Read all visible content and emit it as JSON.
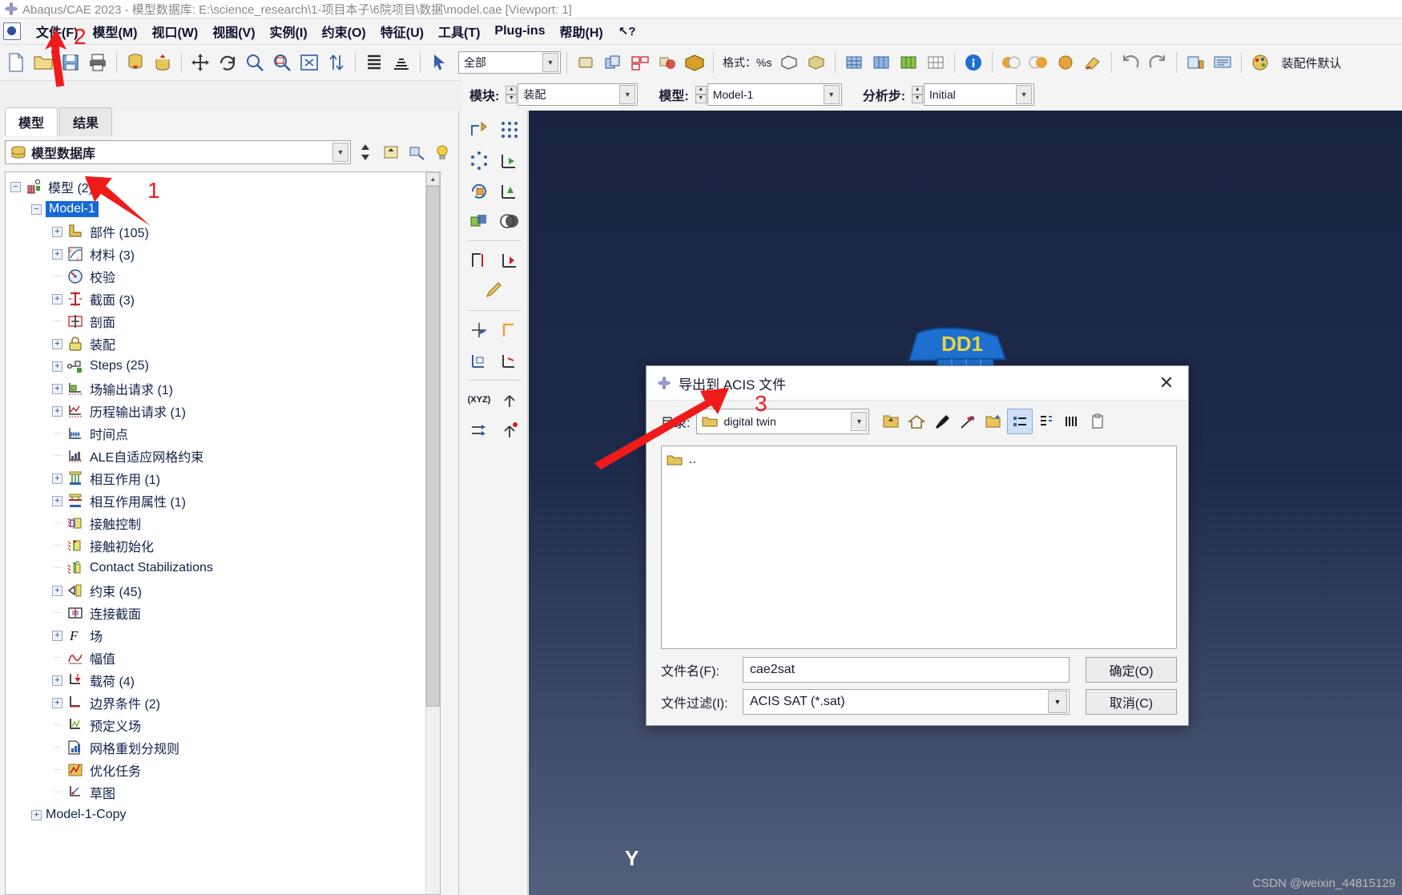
{
  "window": {
    "title": "Abaqus/CAE 2023 - 模型数据库: E:\\science_research\\1-项目本子\\6院项目\\数据\\model.cae [Viewport: 1]",
    "app_icon": "abaqus-logo-icon"
  },
  "menubar": {
    "items": [
      {
        "label": "文件(F)",
        "name": "menu-file"
      },
      {
        "label": "模型(M)",
        "name": "menu-model"
      },
      {
        "label": "视口(W)",
        "name": "menu-viewport"
      },
      {
        "label": "视图(V)",
        "name": "menu-view"
      },
      {
        "label": "实例(I)",
        "name": "menu-instance"
      },
      {
        "label": "约束(O)",
        "name": "menu-constraint"
      },
      {
        "label": "特征(U)",
        "name": "menu-feature"
      },
      {
        "label": "工具(T)",
        "name": "menu-tools"
      },
      {
        "label": "Plug-ins",
        "name": "menu-plugins"
      },
      {
        "label": "帮助(H)",
        "name": "menu-help"
      }
    ],
    "context_help": "↖?"
  },
  "toolbar": {
    "selection_scope": "全部",
    "render_style_label": "格式：%s",
    "assembly_default_label": "装配件默认"
  },
  "context_bar": {
    "module_label": "模块:",
    "module_value": "装配",
    "model_label": "模型:",
    "model_value": "Model-1",
    "step_label": "分析步:",
    "step_value": "Initial"
  },
  "left_panel": {
    "tabs": [
      {
        "label": "模型",
        "active": true,
        "name": "tab-model"
      },
      {
        "label": "结果",
        "active": false,
        "name": "tab-results"
      }
    ],
    "tree_selector": "模型数据库",
    "tree": [
      {
        "label": "模型 (2)",
        "depth": 0,
        "expander": "minus",
        "icon": "models-icon",
        "selected": false
      },
      {
        "label": "Model-1",
        "depth": 1,
        "expander": "minus",
        "icon": "",
        "selected": true
      },
      {
        "label": "部件 (105)",
        "depth": 2,
        "expander": "plus",
        "icon": "parts-icon",
        "selected": false
      },
      {
        "label": "材料 (3)",
        "depth": 2,
        "expander": "plus",
        "icon": "materials-icon",
        "selected": false
      },
      {
        "label": "校验",
        "depth": 2,
        "expander": "none",
        "icon": "calibration-icon",
        "selected": false
      },
      {
        "label": "截面 (3)",
        "depth": 2,
        "expander": "plus",
        "icon": "sections-icon",
        "selected": false
      },
      {
        "label": "剖面",
        "depth": 2,
        "expander": "none",
        "icon": "profiles-icon",
        "selected": false
      },
      {
        "label": "装配",
        "depth": 2,
        "expander": "plus",
        "icon": "assembly-icon",
        "selected": false
      },
      {
        "label": "Steps (25)",
        "depth": 2,
        "expander": "plus",
        "icon": "steps-icon",
        "selected": false
      },
      {
        "label": "场输出请求 (1)",
        "depth": 2,
        "expander": "plus",
        "icon": "field-output-icon",
        "selected": false
      },
      {
        "label": "历程输出请求 (1)",
        "depth": 2,
        "expander": "plus",
        "icon": "history-output-icon",
        "selected": false
      },
      {
        "label": "时间点",
        "depth": 2,
        "expander": "none",
        "icon": "time-points-icon",
        "selected": false
      },
      {
        "label": "ALE自适应网格约束",
        "depth": 2,
        "expander": "none",
        "icon": "ale-mesh-icon",
        "selected": false
      },
      {
        "label": "相互作用  (1)",
        "depth": 2,
        "expander": "plus",
        "icon": "interactions-icon",
        "selected": false
      },
      {
        "label": "相互作用属性 (1)",
        "depth": 2,
        "expander": "plus",
        "icon": "interaction-prop-icon",
        "selected": false
      },
      {
        "label": "接触控制",
        "depth": 2,
        "expander": "none",
        "icon": "contact-controls-icon",
        "selected": false
      },
      {
        "label": "接触初始化",
        "depth": 2,
        "expander": "none",
        "icon": "contact-init-icon",
        "selected": false
      },
      {
        "label": "Contact Stabilizations",
        "depth": 2,
        "expander": "none",
        "icon": "contact-stab-icon",
        "selected": false
      },
      {
        "label": "约束 (45)",
        "depth": 2,
        "expander": "plus",
        "icon": "constraints-icon",
        "selected": false
      },
      {
        "label": "连接截面",
        "depth": 2,
        "expander": "none",
        "icon": "connector-section-icon",
        "selected": false
      },
      {
        "label": "场",
        "depth": 2,
        "expander": "plus",
        "icon": "fields-icon",
        "selected": false
      },
      {
        "label": "幅值",
        "depth": 2,
        "expander": "none",
        "icon": "amplitudes-icon",
        "selected": false
      },
      {
        "label": "载荷 (4)",
        "depth": 2,
        "expander": "plus",
        "icon": "loads-icon",
        "selected": false
      },
      {
        "label": "边界条件 (2)",
        "depth": 2,
        "expander": "plus",
        "icon": "bcs-icon",
        "selected": false
      },
      {
        "label": "预定义场",
        "depth": 2,
        "expander": "none",
        "icon": "predefined-field-icon",
        "selected": false
      },
      {
        "label": "网格重划分规则",
        "depth": 2,
        "expander": "none",
        "icon": "remeshing-icon",
        "selected": false
      },
      {
        "label": "优化任务",
        "depth": 2,
        "expander": "none",
        "icon": "optimization-icon",
        "selected": false
      },
      {
        "label": "草图",
        "depth": 2,
        "expander": "none",
        "icon": "sketches-icon",
        "selected": false
      },
      {
        "label": "Model-1-Copy",
        "depth": 1,
        "expander": "plus",
        "icon": "",
        "selected": false
      }
    ]
  },
  "viewport": {
    "axis_label_y": "Y"
  },
  "dialog": {
    "title": "导出到 ACIS 文件",
    "icon": "abaqus-logo-icon",
    "close": "✕",
    "directory_label": "目录:",
    "directory_value": "digital twin",
    "toolbuttons": [
      {
        "name": "parent-directory-icon",
        "selected": false
      },
      {
        "name": "home-directory-icon",
        "selected": false
      },
      {
        "name": "work-directory-icon",
        "selected": false
      },
      {
        "name": "bookmark-icon",
        "selected": false
      },
      {
        "name": "new-folder-icon",
        "selected": false
      },
      {
        "name": "detail-view-icon",
        "selected": true
      },
      {
        "name": "list-view-icon",
        "selected": false
      },
      {
        "name": "columns-view-icon",
        "selected": false
      },
      {
        "name": "clipboard-icon",
        "selected": false
      }
    ],
    "file_list": [
      {
        "name": "..",
        "icon": "folder-icon"
      }
    ],
    "filename_label": "文件名(F):",
    "filename_value": "cae2sat",
    "filter_label": "文件过滤(I):",
    "filter_value": "ACIS SAT (*.sat)",
    "ok_label": "确定(O)",
    "cancel_label": "取消(C)"
  },
  "annotations": [
    {
      "number": "1",
      "name": "annotation-1"
    },
    {
      "number": "2",
      "name": "annotation-2"
    },
    {
      "number": "3",
      "name": "annotation-3"
    }
  ],
  "watermark": "CSDN @weixin_44815129",
  "colors": {
    "accent_red": "#ef1b1b",
    "selection_blue": "#1669d8",
    "viewport_top": "#19233f",
    "viewport_bottom": "#53607c",
    "model_blue": "#1f6fd0"
  }
}
